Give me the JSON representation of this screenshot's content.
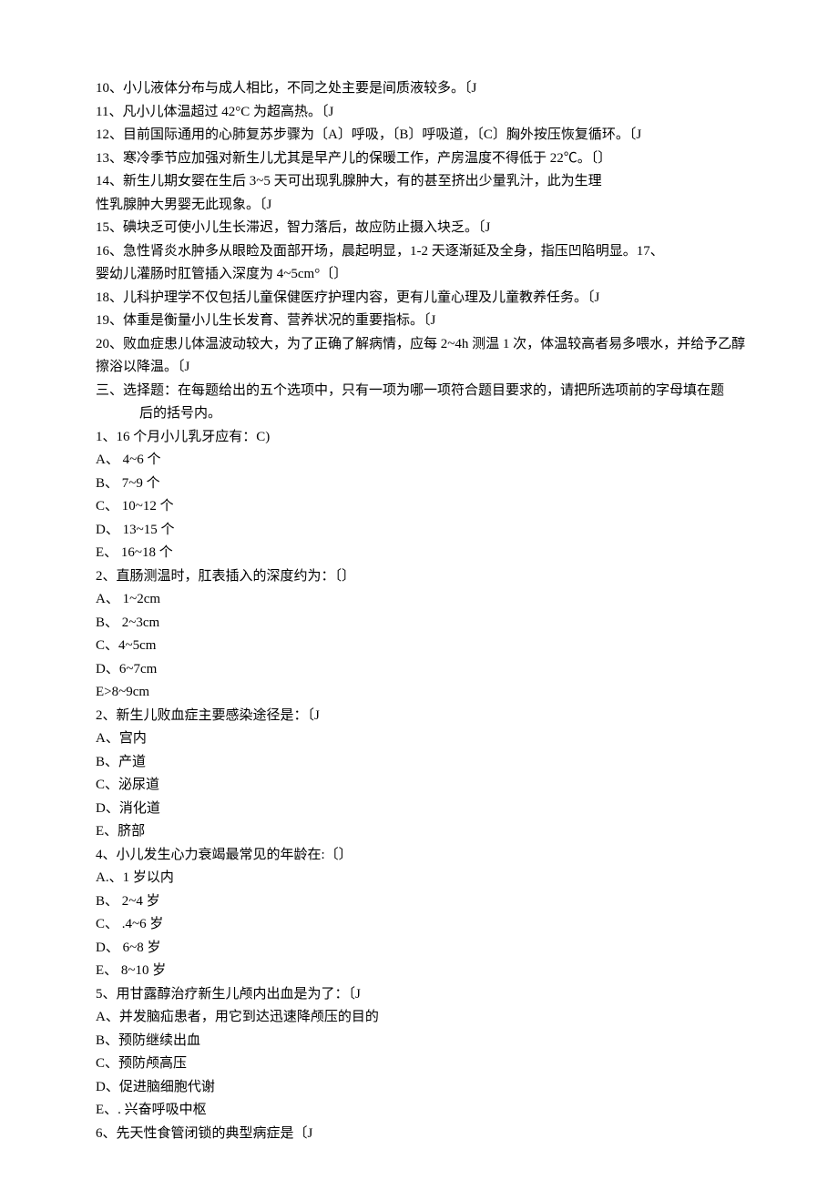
{
  "lines": [
    "10、小儿液体分布与成人相比，不同之处主要是间质液较多。〔J",
    "11、凡小儿体温超过 42°C 为超高热。〔J",
    "12、目前国际通用的心肺复苏步骤为〔A〕呼吸，〔B〕呼吸道，〔C〕胸外按压恢复循环。〔J",
    "13、寒冷季节应加强对新生儿尤其是早产儿的保暖工作，产房温度不得低于 22℃。〔〕",
    "14、新生儿期女婴在生后 3~5 天可出现乳腺肿大，有的甚至挤出少量乳汁，此为生理",
    "性乳腺肿大男婴无此现象。〔J",
    "15、碘块乏可使小儿生长滞迟，智力落后，故应防止摄入块乏。〔J",
    "16、急性肾炎水肿多从眼睑及面部开场，晨起明显，1-2 天逐渐延及全身，指压凹陷明显。17、",
    "婴幼儿灌肠时肛管插入深度为 4~5cm°〔〕",
    "18、儿科护理学不仅包括儿童保健医疗护理内容，更有儿童心理及儿童教养任务。〔J",
    "19、体重是衡量小儿生长发育、营养状况的重要指标。〔J",
    "20、败血症患儿体温波动较大，为了正确了解病情，应每 2~4h 测温 1 次，体温较高者易多喂水，并给予乙醇擦浴以降温。〔J",
    "三、选择题：在每题给出的五个选项中，只有一项为哪一项符合题目要求的，请把所选项前的字母填在题"
  ],
  "indent_line": "后的括号内。",
  "lines2": [
    "1、16 个月小儿乳牙应有：C)",
    "A、 4~6 个",
    "B、 7~9 个",
    "C、 10~12 个",
    "D、 13~15 个",
    "E、 16~18 个",
    "2、直肠测温时，肛表插入的深度约为：〔〕",
    "A、 1~2cm",
    "B、 2~3cm",
    "C、4~5cm",
    "D、6~7cm",
    "E>8~9cm",
    "2、新生儿败血症主要感染途径是：〔J",
    "A、宫内",
    "B、产道",
    "C、泌尿道",
    "D、消化道",
    "E、脐部",
    "4、小儿发生心力衰竭最常见的年龄在:〔〕",
    "A.、1 岁以内",
    "B、 2~4 岁",
    "C、 .4~6 岁",
    "D、 6~8 岁",
    "E、 8~10 岁",
    "5、用甘露醇治疗新生儿颅内出血是为了：〔J",
    "A、并发脑疝患者，用它到达迅速降颅压的目的",
    "B、预防继续出血",
    "C、预防颅高压",
    "D、促进脑细胞代谢",
    "E、. 兴奋呼吸中枢",
    "6、先天性食管闭锁的典型病症是〔J"
  ]
}
